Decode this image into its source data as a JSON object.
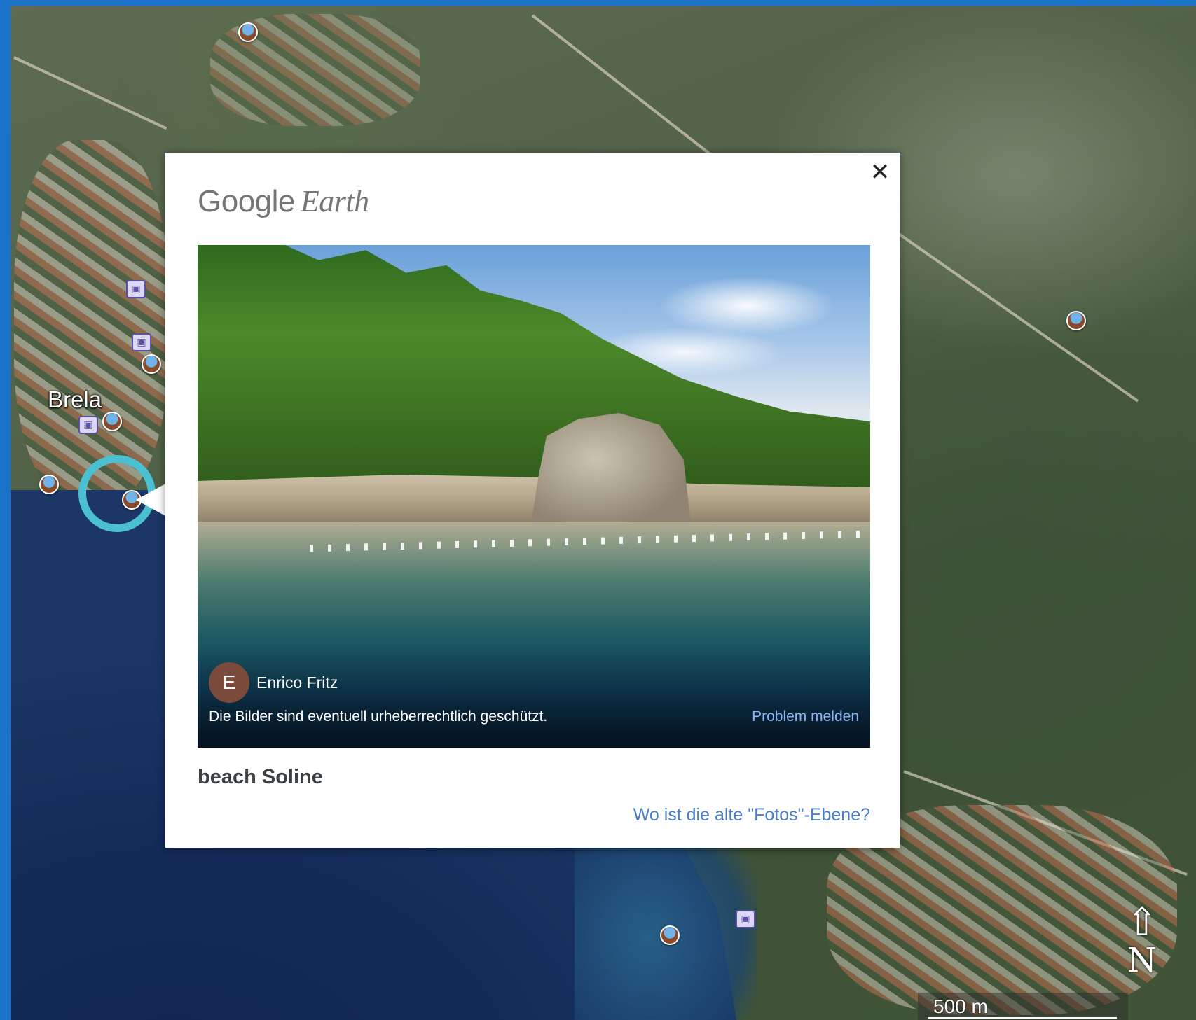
{
  "map": {
    "place_label": "Brela",
    "scale_label": "500 m",
    "compass_letter": "N",
    "accent_ring_color": "#4bc0d2"
  },
  "popup": {
    "logo_brand": "Google",
    "logo_product": "Earth",
    "close_symbol": "✕",
    "photo": {
      "author_initial": "E",
      "author_name": "Enrico Fritz",
      "copyright_notice": "Die Bilder sind eventuell urheberrechtlich geschützt.",
      "report_link": "Problem melden"
    },
    "place_title": "beach Soline",
    "help_link": "Wo ist die alte \"Fotos\"-Ebene?"
  },
  "icons": [
    "close-icon",
    "photo-marker-icon",
    "hotel-icon",
    "compass-north-icon"
  ],
  "colors": {
    "link": "#4a7fd0",
    "photo_link": "#8ab4f8",
    "avatar": "#7a4a3a",
    "window_edge": "#1a73c8"
  }
}
